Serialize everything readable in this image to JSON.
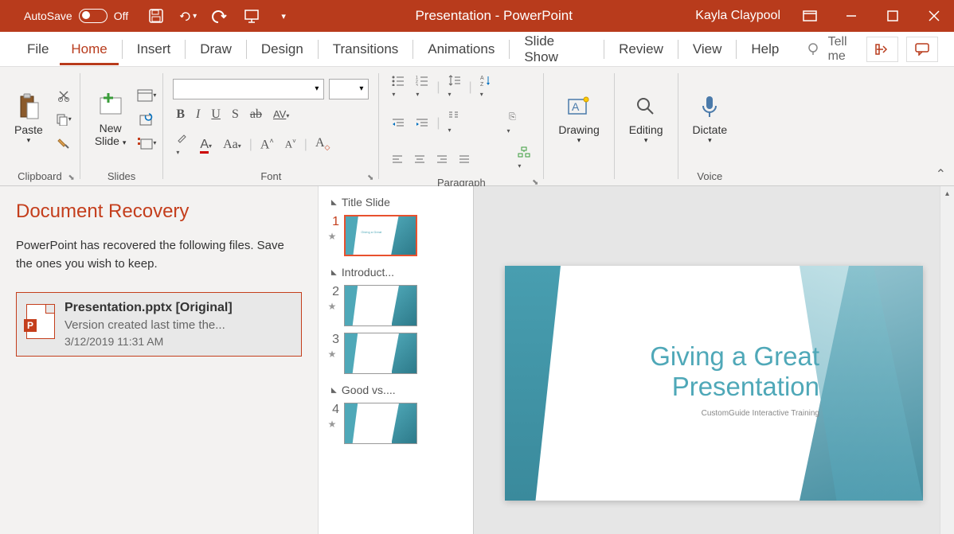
{
  "titlebar": {
    "autosave_label": "AutoSave",
    "autosave_state": "Off",
    "title": "Presentation - PowerPoint",
    "user": "Kayla Claypool"
  },
  "tabs": {
    "file": "File",
    "home": "Home",
    "insert": "Insert",
    "draw": "Draw",
    "design": "Design",
    "transitions": "Transitions",
    "animations": "Animations",
    "slideshow": "Slide Show",
    "review": "Review",
    "view": "View",
    "help": "Help",
    "tellme": "Tell me"
  },
  "ribbon": {
    "paste": "Paste",
    "clipboard": "Clipboard",
    "new_slide": "New",
    "slide_drop": "Slide",
    "slides": "Slides",
    "font": "Font",
    "paragraph": "Paragraph",
    "drawing": "Drawing",
    "editing": "Editing",
    "dictate": "Dictate",
    "voice": "Voice"
  },
  "recovery": {
    "heading": "Document Recovery",
    "body": "PowerPoint has recovered the following files.  Save the ones you wish to keep.",
    "item": {
      "name": "Presentation.pptx  [Original]",
      "version": "Version created last time the...",
      "date": "3/12/2019 11:31 AM",
      "badge": "P"
    }
  },
  "sections": {
    "s1": "Title Slide",
    "s2": "Introduct...",
    "s3": "Good vs....",
    "nums": {
      "n1": "1",
      "n2": "2",
      "n3": "3",
      "n4": "4"
    }
  },
  "slide": {
    "title": "Giving a Great Presentation",
    "subtitle": "CustomGuide Interactive Training"
  }
}
